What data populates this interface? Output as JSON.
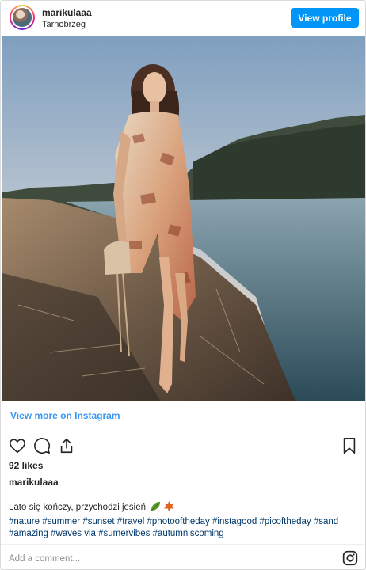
{
  "header": {
    "username": "marikulaaa",
    "location": "Tarnobrzeg",
    "view_profile_label": "View profile"
  },
  "post": {
    "view_more_label": "View more on Instagram",
    "likes_text": "92 likes",
    "owner_username": "marikulaaa",
    "caption_text": "Lato się kończy, przychodzi jesień",
    "hashtags_text": "#nature #summer #sunset #travel #photooftheday #instagood #picoftheday #sand #amazing #waves via #sumervibes #autumniscoming",
    "comment_placeholder": "Add a comment..."
  },
  "icons": {
    "like": "heart-icon",
    "comment": "comment-bubble-icon",
    "share": "share-icon",
    "save": "bookmark-icon",
    "brand": "instagram-icon"
  },
  "colors": {
    "accent": "#0095f6",
    "link": "#3897f0",
    "text": "#262626"
  }
}
